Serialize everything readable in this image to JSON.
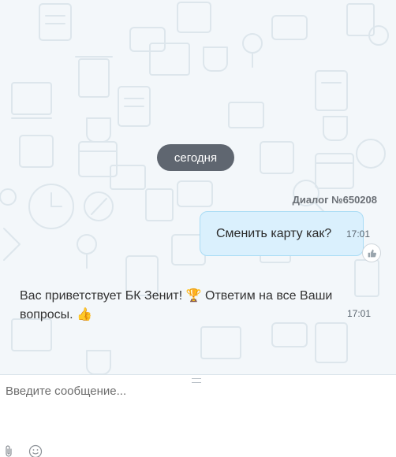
{
  "chat": {
    "date_separator": "сегодня",
    "dialog_label": "Диалог №650208",
    "outgoing": {
      "text": "Сменить карту как?",
      "time": "17:01"
    },
    "incoming": {
      "text_part1": "Вас приветствует БК Зенит!",
      "emoji1": "🏆",
      "text_part2": "Ответим на все Ваши вопросы.",
      "emoji2": "👍",
      "time": "17:01"
    }
  },
  "composer": {
    "placeholder": "Введите сообщение...",
    "icons": [
      "attach-icon",
      "emoji-icon"
    ]
  },
  "colors": {
    "chat_bg": "#f3f7fa",
    "outgoing_bubble": "#daf0fd",
    "outgoing_border": "#a9dcf5",
    "date_pill": "#5f6670"
  }
}
